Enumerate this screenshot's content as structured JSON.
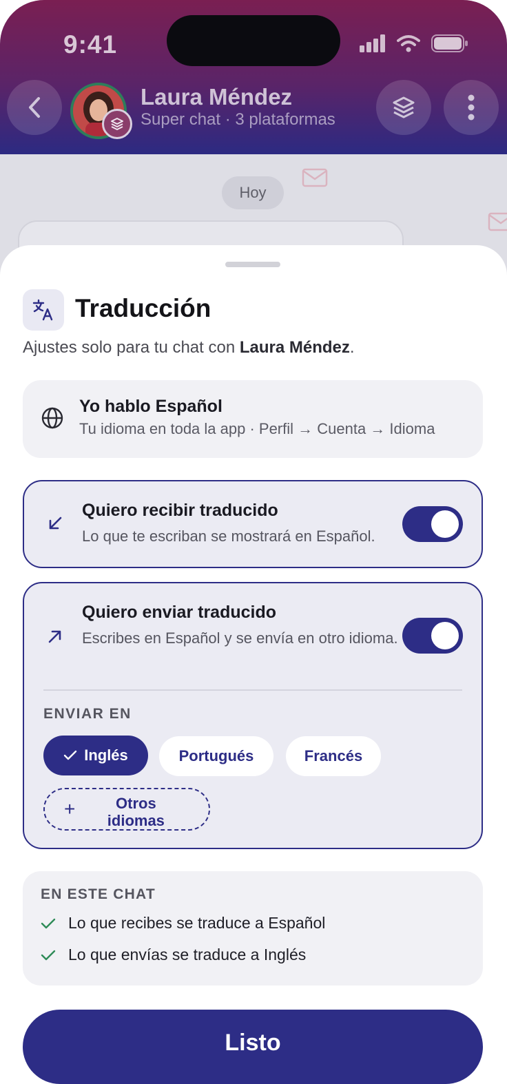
{
  "status_bar": {
    "time": "9:41"
  },
  "chat_header": {
    "contact_name": "Laura Méndez",
    "contact_subtitle": "Super chat · 3 plataformas"
  },
  "chat": {
    "day_label": "Hoy"
  },
  "sheet": {
    "title": "Traducción",
    "subtitle_prefix": "Ajustes solo para tu chat con ",
    "subtitle_name": "Laura Méndez",
    "subtitle_suffix": ".",
    "my_language": {
      "title": "Yo hablo Español",
      "subtitle": "Tu idioma en toda la app · Perfil → Cuenta → Idioma"
    },
    "receive_option": {
      "title": "Quiero recibir traducido",
      "description": "Lo que te escriban se mostrará en Español.",
      "enabled": true
    },
    "send_option": {
      "title": "Quiero enviar traducido",
      "description": "Escribes en Español y se envía en otro idioma.",
      "enabled": true,
      "send_in_label": "ENVIAR EN",
      "languages": [
        {
          "label": "Inglés",
          "selected": true
        },
        {
          "label": "Portugués",
          "selected": false
        },
        {
          "label": "Francés",
          "selected": false
        }
      ],
      "more_languages": "Otros idiomas"
    },
    "summary": {
      "label": "EN ESTE CHAT",
      "items": [
        "Lo que recibes se traduce a Español",
        "Lo que envías se traduce a Inglés"
      ]
    },
    "done_button": "Listo"
  },
  "colors": {
    "accent": "#2d2d86",
    "header_gradient_top": "#7a1f52",
    "header_gradient_bottom": "#2c2a82",
    "success_check": "#2e8b57",
    "card_background": "#f1f1f5"
  },
  "icons": {
    "title": "translate-icon",
    "language": "globe-icon",
    "receive": "arrow-down-left-icon",
    "send": "arrow-up-right-icon",
    "selected_chip": "check-icon",
    "more": "plus-icon",
    "summary": "check-icon"
  }
}
